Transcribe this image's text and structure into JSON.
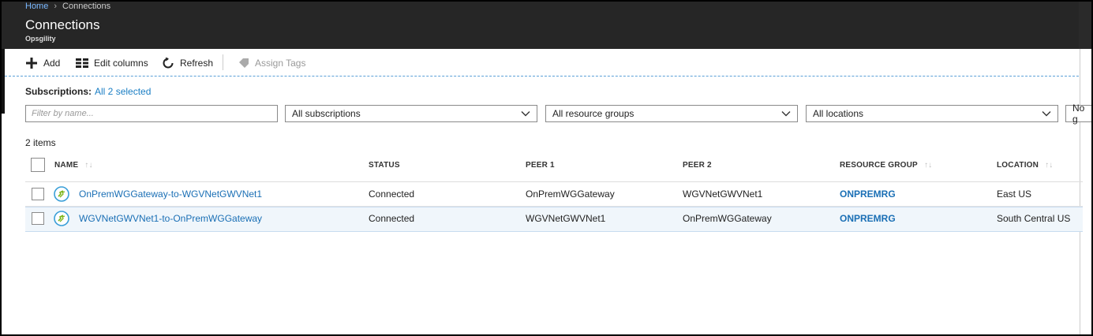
{
  "breadcrumb": {
    "home": "Home",
    "separator": "›",
    "current": "Connections"
  },
  "header": {
    "title": "Connections",
    "subtitle": "Opsgility"
  },
  "toolbar": {
    "add": "Add",
    "edit_columns": "Edit columns",
    "refresh": "Refresh",
    "assign_tags": "Assign Tags"
  },
  "subscriptions": {
    "label": "Subscriptions:",
    "value": "All 2 selected"
  },
  "filters": {
    "name_placeholder": "Filter by name...",
    "subscriptions": "All subscriptions",
    "resource_groups": "All resource groups",
    "locations": "All locations",
    "grouping": "No g"
  },
  "items_count": "2 items",
  "table": {
    "columns": [
      "NAME",
      "STATUS",
      "PEER 1",
      "PEER 2",
      "RESOURCE GROUP",
      "LOCATION"
    ],
    "rows": [
      {
        "name": "OnPremWGGateway-to-WGVNetGWVNet1",
        "status": "Connected",
        "peer1": "OnPremWGGateway",
        "peer2": "WGVNetGWVNet1",
        "resource_group": "ONPREMRG",
        "location": "East US"
      },
      {
        "name": "WGVNetGWVNet1-to-OnPremWGGateway",
        "status": "Connected",
        "peer1": "WGVNetGWVNet1",
        "peer2": "OnPremWGGateway",
        "resource_group": "ONPREMRG",
        "location": "South Central US"
      }
    ]
  },
  "colors": {
    "header_bg": "#262626",
    "link": "#1a6fb5",
    "accent": "#1a7ec4"
  },
  "icons": {
    "add": "plus-icon",
    "edit_columns": "columns-icon",
    "refresh": "refresh-icon",
    "assign_tags": "tag-icon",
    "connection": "connection-icon",
    "dropdown": "chevron-down-icon"
  }
}
